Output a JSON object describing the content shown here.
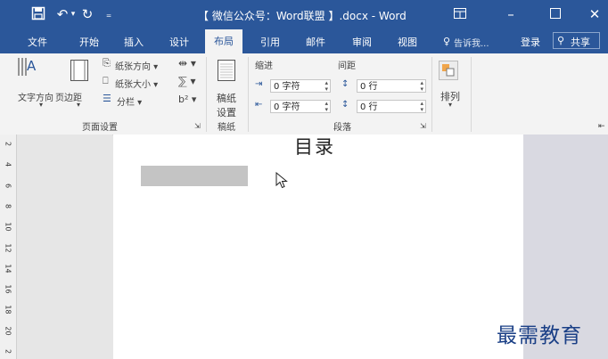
{
  "titlebar": {
    "title": "【 微信公众号：Word联盟 】.docx - Word",
    "save_icon": "save-icon",
    "undo_icon": "undo-icon",
    "undo_dropdown": "▾",
    "redo_icon": "redo-icon",
    "customize_icon": "customize-icon",
    "ribbon_display_icon": "ribbon-display-icon",
    "minimize_icon": "minimize-icon",
    "maximize_icon": "maximize-icon",
    "close_icon": "close-icon"
  },
  "tabs": [
    "文件",
    "开始",
    "插入",
    "设计",
    "布局",
    "引用",
    "邮件",
    "审阅",
    "视图"
  ],
  "active_tab": "布局",
  "tellme": "告诉我...",
  "login": "登录",
  "share": "共享",
  "ribbon": {
    "page_setup": {
      "group_label": "页面设置",
      "text_direction": "文字方向",
      "margins": "页边距",
      "orientation": "纸张方向",
      "size": "纸张大小",
      "columns": "分栏",
      "breaks_icon": "breaks-icon",
      "line_numbers_icon": "line-numbers-icon",
      "hyphenation_icon": "hyphenation-icon"
    },
    "manuscript": {
      "group_label": "稿纸",
      "button_line1": "稿纸",
      "button_line2": "设置"
    },
    "paragraph": {
      "group_label": "段落",
      "indent_label": "缩进",
      "spacing_label": "间距",
      "indent_left": "0 字符",
      "indent_right": "0 字符",
      "spacing_before": "0 行",
      "spacing_after": "0 行"
    },
    "arrange": {
      "label": "排列"
    }
  },
  "ruler_numbers": [
    "2",
    "4",
    "6",
    "8",
    "10",
    "12",
    "14",
    "16",
    "18",
    "20",
    "2"
  ],
  "document": {
    "heading": "目录",
    "watermark": "最需教育"
  },
  "colors": {
    "accent": "#2b579a",
    "ribbon_bg": "#f3f3f3",
    "watermark": "#1a3f86"
  }
}
